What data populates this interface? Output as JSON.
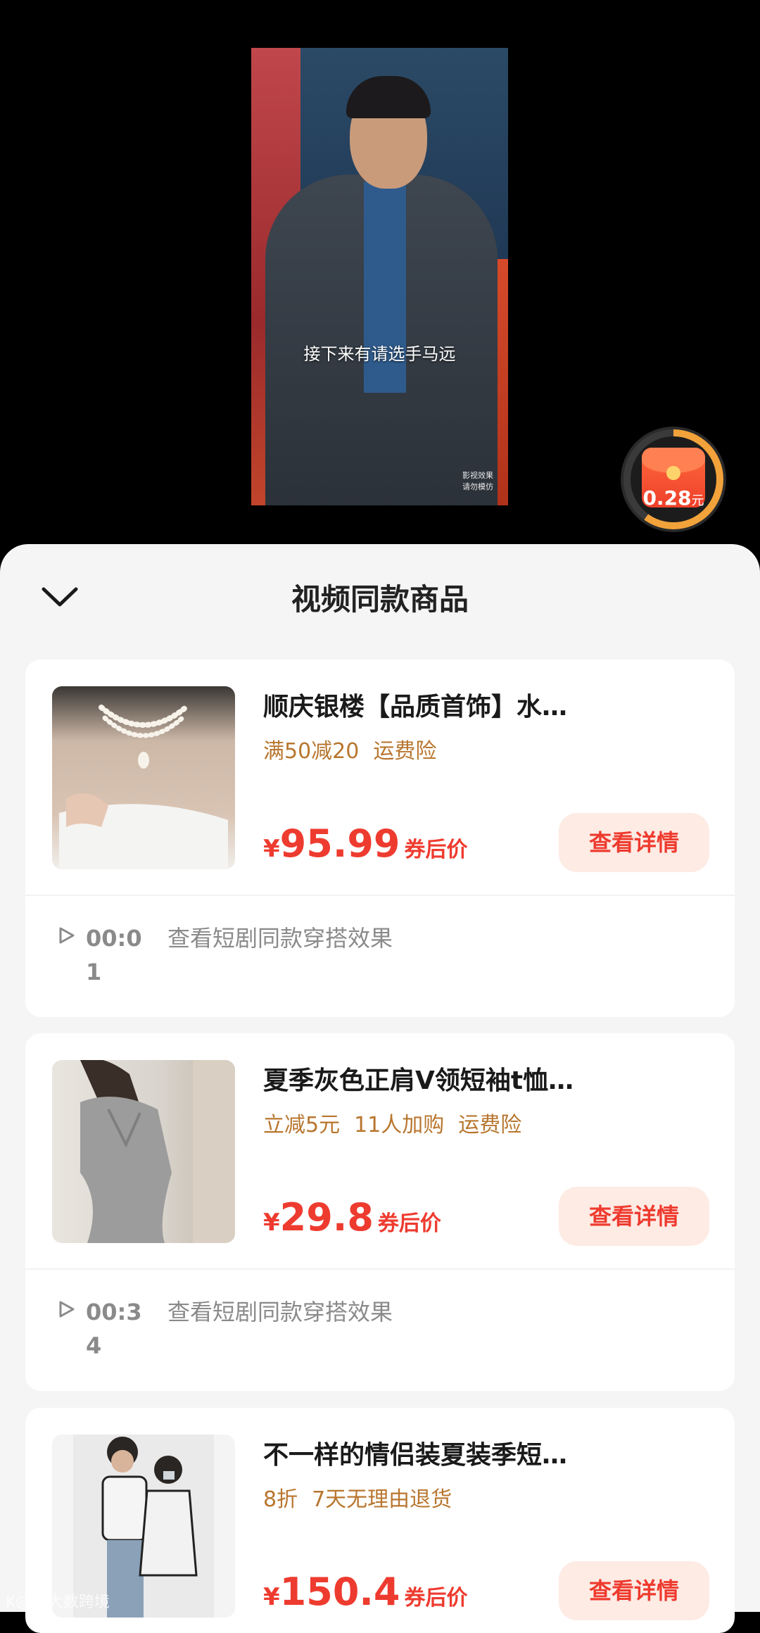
{
  "video": {
    "subtitle": "接下来有请选手马远",
    "disclaimer_line1": "影视效果",
    "disclaimer_line2": "请勿模仿"
  },
  "red_packet": {
    "amount": "0.28",
    "unit": "元",
    "progress": 0.6
  },
  "sheet": {
    "title": "视频同款商品"
  },
  "products": [
    {
      "title": "顺庆银楼【品质首饰】水…",
      "tags": [
        "满50减20",
        "运费险"
      ],
      "price_symbol": "¥",
      "price": "95.99",
      "price_suffix": "券后价",
      "button": "查看详情",
      "time": "00:01",
      "play_text": "查看短剧同款穿搭效果"
    },
    {
      "title": "夏季灰色正肩V领短袖t恤…",
      "tags": [
        "立减5元",
        "11人加购",
        "运费险"
      ],
      "price_symbol": "¥",
      "price": "29.8",
      "price_suffix": "券后价",
      "button": "查看详情",
      "time": "00:34",
      "play_text": "查看短剧同款穿搭效果"
    },
    {
      "title": "不一样的情侣装夏装季短…",
      "tags": [
        "8折",
        "7天无理由退货"
      ],
      "price_symbol": "¥",
      "price": "150.4",
      "price_suffix": "券后价",
      "button": "查看详情"
    }
  ],
  "watermark": "K◎◎ 大数跨境",
  "colors": {
    "price": "#ee3b2f",
    "tag": "#b8762f",
    "button_bg": "#fdebe4",
    "sheet_bg": "#f5f5f5"
  }
}
